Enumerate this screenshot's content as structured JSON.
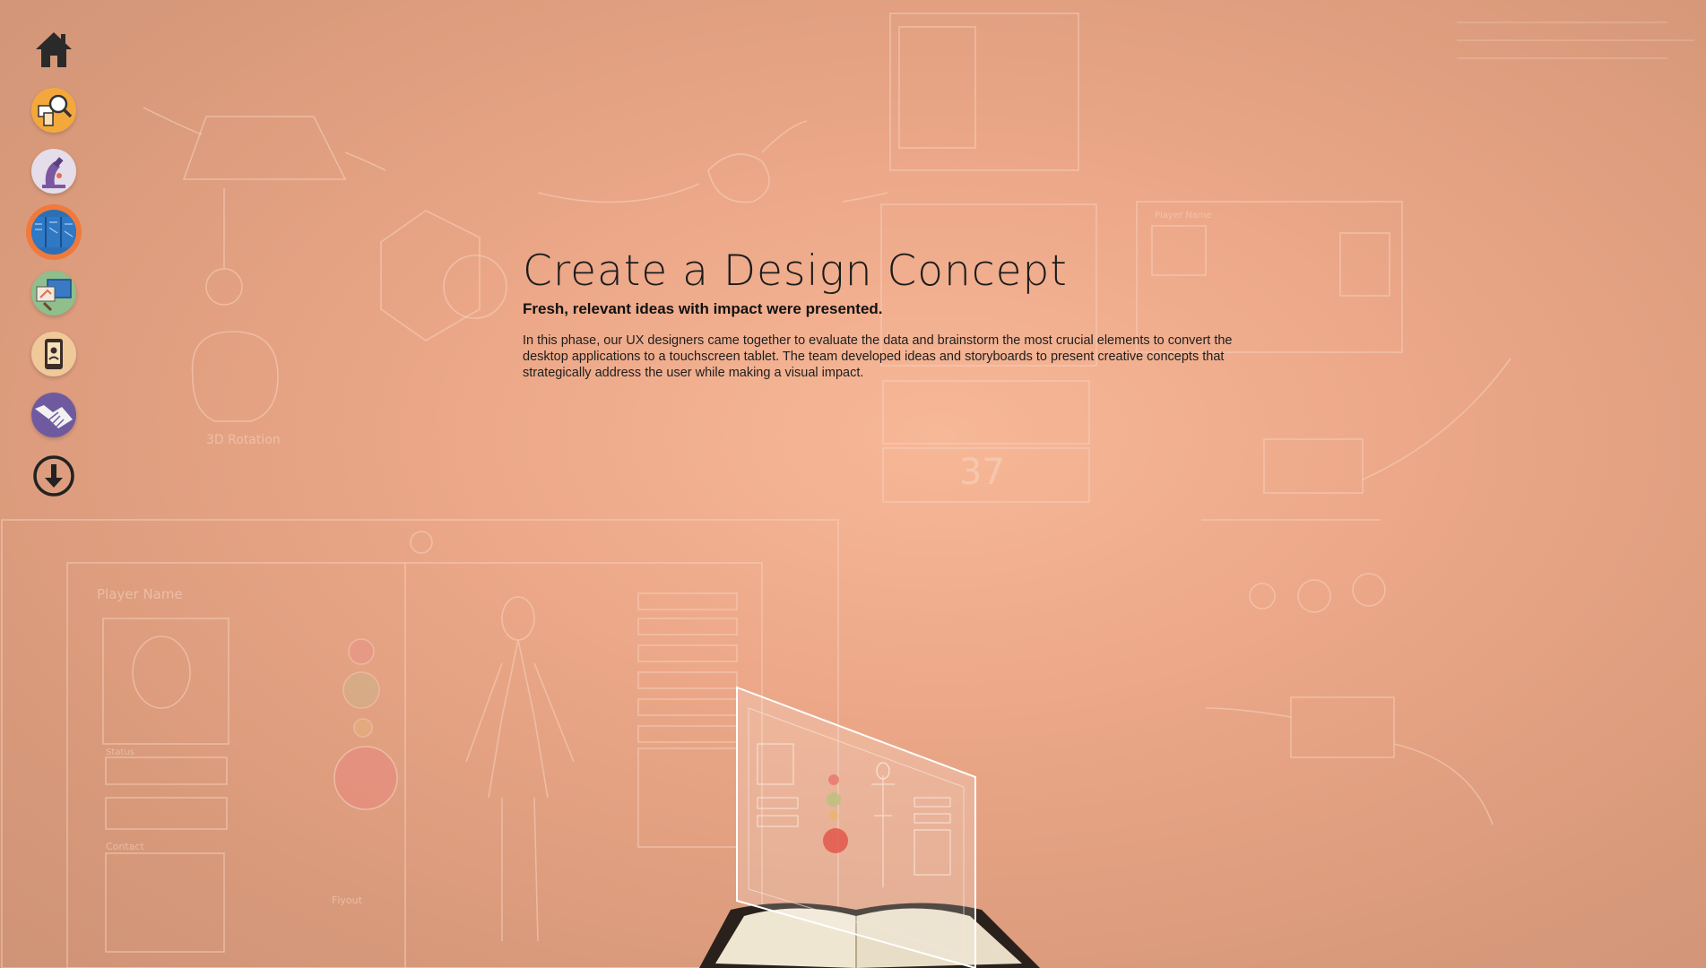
{
  "sidebar": {
    "items": [
      {
        "name": "home",
        "icon": "home-icon"
      },
      {
        "name": "research",
        "icon": "magnifier-devices-icon"
      },
      {
        "name": "discovery",
        "icon": "microscope-icon"
      },
      {
        "name": "design-concept",
        "icon": "blueprint-icon",
        "active": true
      },
      {
        "name": "prototype",
        "icon": "paint-screen-icon"
      },
      {
        "name": "mobile",
        "icon": "tablet-icon"
      },
      {
        "name": "handoff",
        "icon": "handshake-icon"
      },
      {
        "name": "download",
        "icon": "download-arrow-icon"
      }
    ]
  },
  "main": {
    "title": "Create a Design Concept",
    "subtitle": "Fresh, relevant ideas with impact were presented.",
    "body": "In this phase, our UX designers came together to evaluate the data and brainstorm the most crucial elements to convert the desktop applications to a touchscreen tablet. The team developed ideas and storyboards to present creative concepts that strategically address the user while making a visual impact."
  },
  "sketch_labels": {
    "player_name": "Player Name",
    "rotation": "3D Rotation",
    "number": "37",
    "flyout": "Flyout",
    "contact": "Contact",
    "status": "Status"
  },
  "colors": {
    "background": "#eca888",
    "accent_active": "#f07a3b",
    "sketch_line": "#f6d3c0"
  }
}
